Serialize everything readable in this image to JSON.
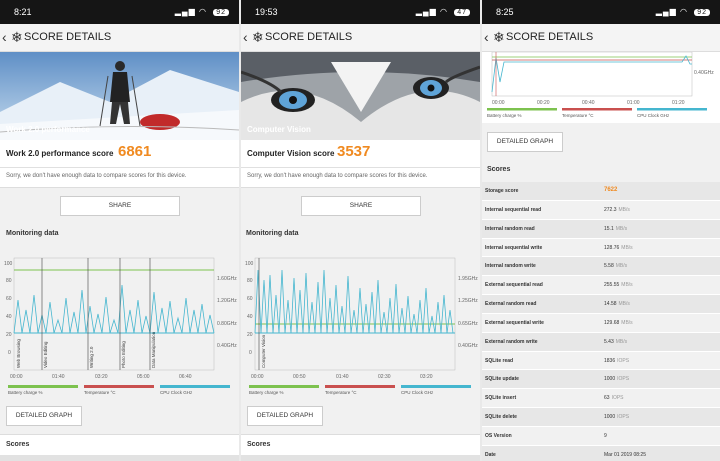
{
  "panels": [
    {
      "status": {
        "time": "8:21",
        "battery": "92"
      },
      "header": {
        "title": "SCORE DETAILS"
      },
      "hero": {
        "label": "Work 2.0 performance"
      },
      "score": {
        "label": "Work 2.0 performance score",
        "value": "6861"
      },
      "note": "Sorry, we don't have enough data to compare scores for this device.",
      "share_label": "SHARE",
      "monitoring_title": "Monitoring data",
      "detailed_graph_label": "DETAILED GRAPH",
      "scores_title": "Scores",
      "chart": {
        "y_ticks": [
          "100",
          "80",
          "60",
          "40",
          "20",
          "0"
        ],
        "right_ticks": [
          "1.60GHz",
          "1.20GHz",
          "0.80GHz",
          "0.40GHz"
        ],
        "x_ticks": [
          "00:00",
          "01:40",
          "03:20",
          "05:00",
          "06:40"
        ],
        "markers": [
          "Web Browsing",
          "Video Editing",
          "Writing 2.0",
          "Photo Editing",
          "Data Manipulation"
        ]
      }
    },
    {
      "status": {
        "time": "19:53",
        "battery": "47"
      },
      "header": {
        "title": "SCORE DETAILS"
      },
      "hero": {
        "label": "Computer Vision"
      },
      "score": {
        "label": "Computer Vision score",
        "value": "3537"
      },
      "note": "Sorry, we don't have enough data to compare scores for this device.",
      "share_label": "SHARE",
      "monitoring_title": "Monitoring data",
      "detailed_graph_label": "DETAILED GRAPH",
      "scores_title": "Scores",
      "chart": {
        "y_ticks": [
          "100",
          "80",
          "60",
          "40",
          "20",
          "0"
        ],
        "right_ticks": [
          "1.95GHz",
          "1.25GHz",
          "0.65GHz",
          "0.40GHz"
        ],
        "x_ticks": [
          "00:00",
          "00:50",
          "01:40",
          "02:30",
          "03:20"
        ],
        "markers": [
          "Computer Vision"
        ]
      }
    },
    {
      "status": {
        "time": "8:25",
        "battery": "92"
      },
      "header": {
        "title": "SCORE DETAILS"
      },
      "chart": {
        "x_ticks": [
          "00:00",
          "00:20",
          "00:40",
          "01:00",
          "01:20"
        ],
        "right_ticks": [
          "0.40GHz"
        ]
      },
      "detailed_graph_label": "DETAILED GRAPH",
      "scores_title": "Scores",
      "rows": [
        {
          "k": "Storage score",
          "v": "7622",
          "u": ""
        },
        {
          "k": "Internal sequential read",
          "v": "272.3",
          "u": "MB/s"
        },
        {
          "k": "Internal random read",
          "v": "15.1",
          "u": "MB/s"
        },
        {
          "k": "Internal sequential write",
          "v": "128.76",
          "u": "MB/s"
        },
        {
          "k": "Internal random write",
          "v": "5.58",
          "u": "MB/s"
        },
        {
          "k": "External sequential read",
          "v": "255.55",
          "u": "MB/s"
        },
        {
          "k": "External random read",
          "v": "14.58",
          "u": "MB/s"
        },
        {
          "k": "External sequential write",
          "v": "129.68",
          "u": "MB/s"
        },
        {
          "k": "External random write",
          "v": "5.43",
          "u": "MB/s"
        },
        {
          "k": "SQLite read",
          "v": "1836",
          "u": "IOPS"
        },
        {
          "k": "SQLite update",
          "v": "1000",
          "u": "IOPS"
        },
        {
          "k": "SQLite insert",
          "v": "63",
          "u": "IOPS"
        },
        {
          "k": "SQLite delete",
          "v": "1000",
          "u": "IOPS"
        },
        {
          "k": "OS Version",
          "v": "9",
          "u": ""
        },
        {
          "k": "Date",
          "v": "Mar 01 2019 08:25",
          "u": ""
        }
      ]
    }
  ],
  "legend": {
    "battery": "Battery charge %",
    "temperature": "Temperature °C",
    "cpu": "CPU Clock GHz"
  },
  "colors": {
    "accent": "#f08a20",
    "battery": "#7dc24f",
    "temperature": "#c9504f",
    "cpu": "#45b6cf"
  },
  "icons": {
    "back": "chevron-left-icon",
    "logo": "snowflake-icon",
    "signal": "signal-icon",
    "wifi": "wifi-icon",
    "battery": "battery-icon"
  }
}
